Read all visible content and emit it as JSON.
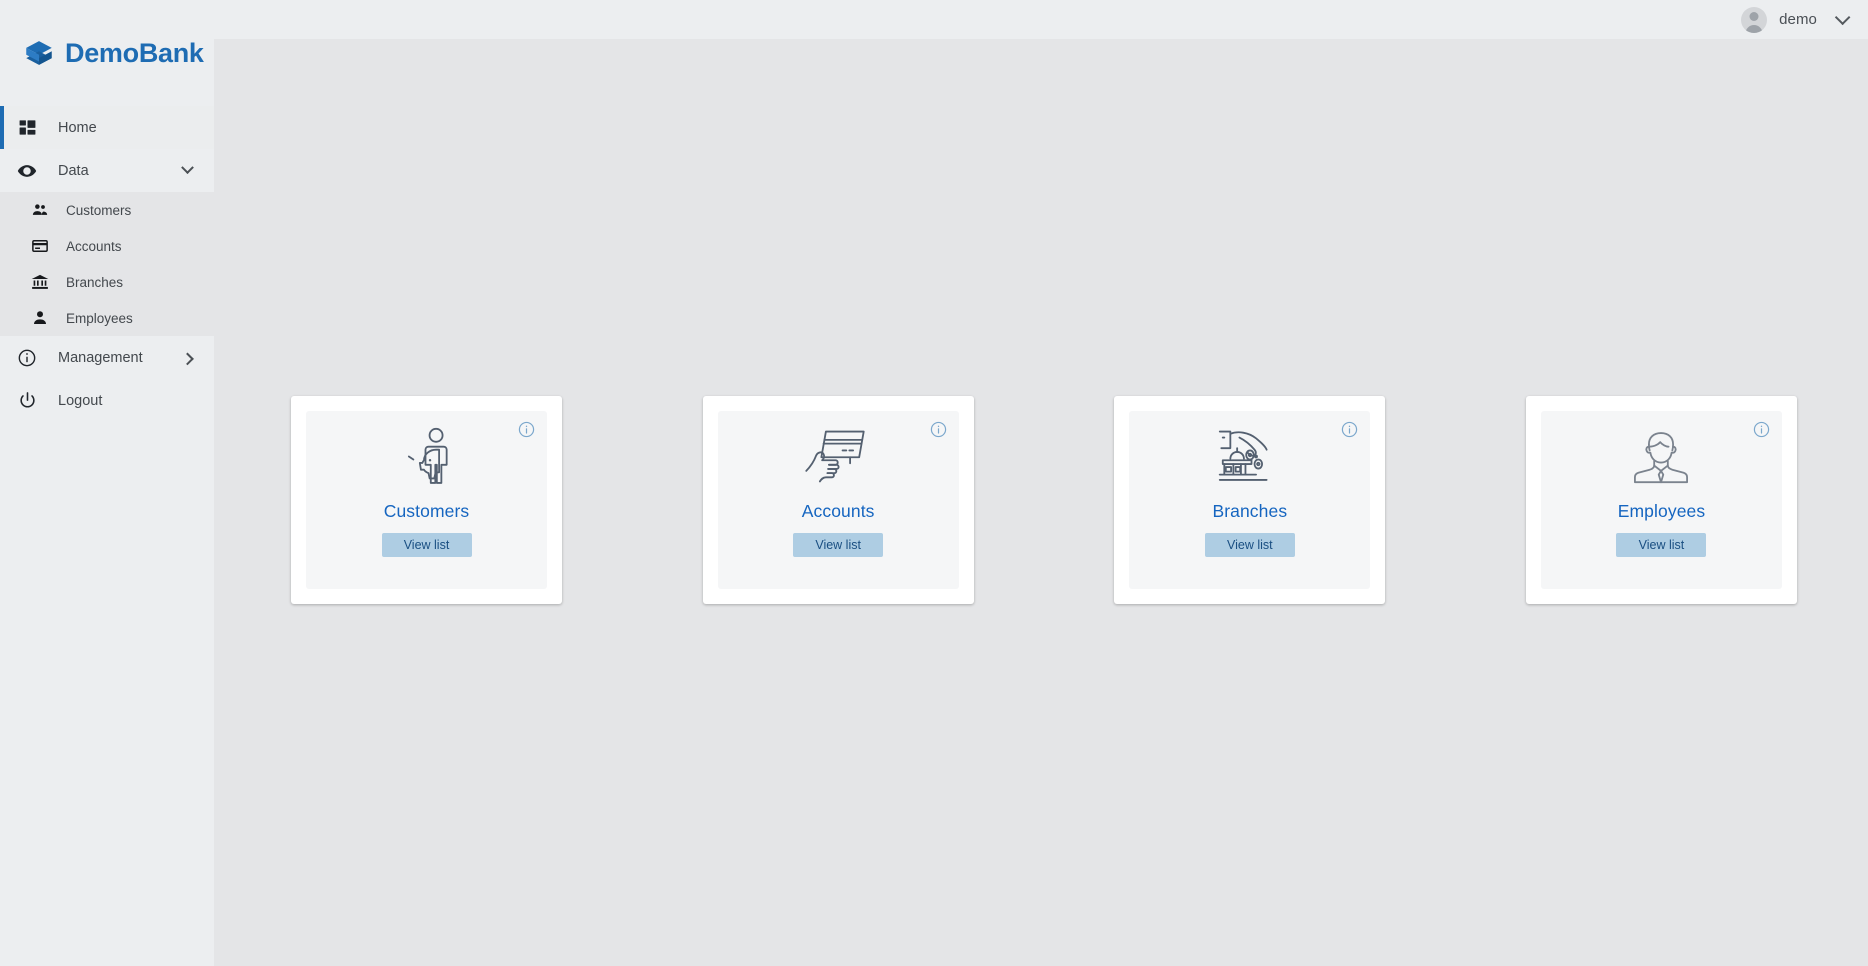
{
  "header": {
    "menu_toggle_icon": "hamburger-icon",
    "user": {
      "name": "demo",
      "avatar_icon": "user-avatar-icon",
      "dropdown_icon": "chevron-down-icon"
    }
  },
  "sidebar": {
    "brand": {
      "name": "DemoBank",
      "logo_icon": "demobank-logo-icon"
    },
    "items": [
      {
        "label": "Home",
        "icon": "dashboard-icon",
        "active": true,
        "expandable": false
      },
      {
        "label": "Data",
        "icon": "eye-icon",
        "active": false,
        "expandable": true,
        "expanded": true,
        "chevron": "chevron-down-icon"
      },
      {
        "label": "Management",
        "icon": "info-circle-icon",
        "active": false,
        "expandable": true,
        "expanded": false,
        "chevron": "chevron-right-icon"
      },
      {
        "label": "Logout",
        "icon": "power-icon",
        "active": false,
        "expandable": false
      }
    ],
    "submenu": [
      {
        "label": "Customers",
        "icon": "people-icon"
      },
      {
        "label": "Accounts",
        "icon": "credit-card-icon"
      },
      {
        "label": "Branches",
        "icon": "bank-icon"
      },
      {
        "label": "Employees",
        "icon": "person-icon"
      }
    ]
  },
  "main": {
    "cards": [
      {
        "title": "Customers",
        "button_label": "View list",
        "art_icon": "person-with-piggybank-icon",
        "info_icon": "info-circle-icon"
      },
      {
        "title": "Accounts",
        "button_label": "View list",
        "art_icon": "hand-holding-credit-card-icon",
        "info_icon": "info-circle-icon"
      },
      {
        "title": "Branches",
        "button_label": "View list",
        "art_icon": "hand-dropping-coins-bank-icon",
        "info_icon": "info-circle-icon"
      },
      {
        "title": "Employees",
        "button_label": "View list",
        "art_icon": "businessman-icon",
        "info_icon": "info-circle-icon"
      }
    ]
  },
  "colors": {
    "brand_blue": "#1e6cb3",
    "title_blue": "#1565c0",
    "button_blue": "#aecde3",
    "sidebar_bg": "#eceef0",
    "submenu_bg": "#e4e5e7",
    "content_bg": "#e4e5e7",
    "card_bg": "#ffffff",
    "card_inner_bg": "#f5f6f7",
    "icon_stroke": "#546070"
  }
}
